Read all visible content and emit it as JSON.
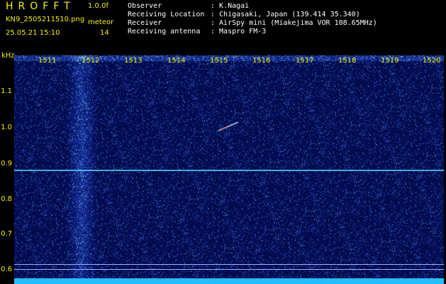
{
  "header": {
    "app_title": "HROFFT",
    "version": "1.0.0f",
    "filename": "KN9_2505211510.png",
    "mode": "meteor",
    "datetime": "25.05.21 15:10",
    "count": "14"
  },
  "info": {
    "rows": [
      {
        "key": "Observer",
        "value": ": K.Nagai"
      },
      {
        "key": "Receiving Location",
        "value": ": Chigasaki, Japan (139.414 35.340)"
      },
      {
        "key": "Receiver",
        "value": ": AirSpy mini (Miakejima VOR 108.65MHz)"
      },
      {
        "key": "Receiving antenna",
        "value": ": Maspro FM-3"
      }
    ]
  },
  "axis": {
    "unit": "kHz",
    "y_labels": [
      "1.1",
      "1.0",
      "0.9",
      "0.8",
      "0.7",
      "0.6"
    ],
    "x_labels": [
      "1511",
      "1512",
      "1513",
      "1514",
      "1515",
      "1516",
      "1517",
      "1518",
      "1519",
      "1520"
    ]
  },
  "colors": {
    "background": "#000000",
    "spectrum": "#06085a",
    "label": "#f2f200",
    "signal_line": "#60d8ff",
    "baseline": "#20c0ff"
  }
}
